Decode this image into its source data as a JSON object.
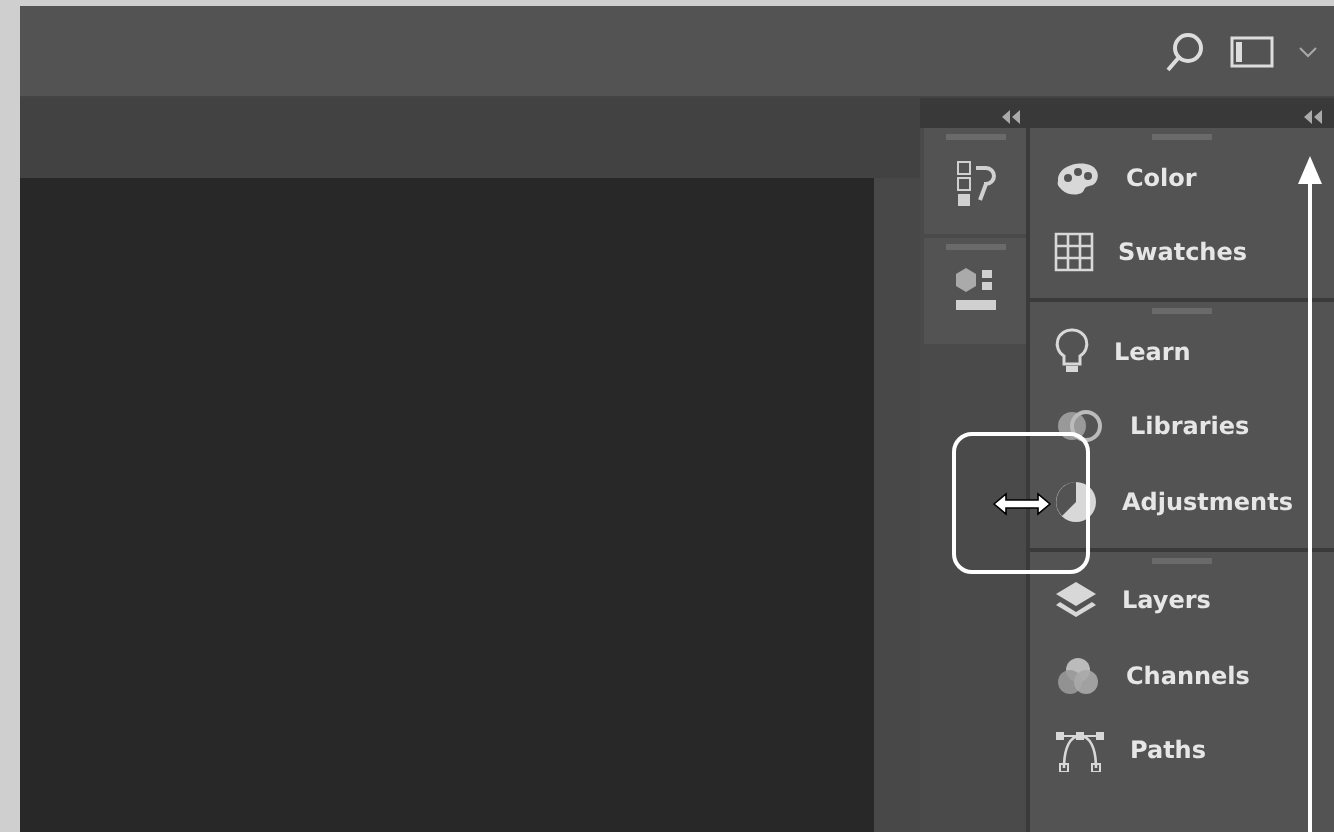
{
  "icon_strip": [
    {
      "kind": "history"
    },
    {
      "kind": "properties"
    }
  ],
  "panel_groups": [
    {
      "items": [
        {
          "kind": "color",
          "label": "Color"
        },
        {
          "kind": "swatches",
          "label": "Swatches"
        }
      ]
    },
    {
      "items": [
        {
          "kind": "learn",
          "label": "Learn"
        },
        {
          "kind": "libraries",
          "label": "Libraries"
        },
        {
          "kind": "adjustments",
          "label": "Adjustments"
        }
      ]
    },
    {
      "items": [
        {
          "kind": "layers",
          "label": "Layers"
        },
        {
          "kind": "channels",
          "label": "Channels"
        },
        {
          "kind": "paths",
          "label": "Paths"
        }
      ]
    }
  ]
}
